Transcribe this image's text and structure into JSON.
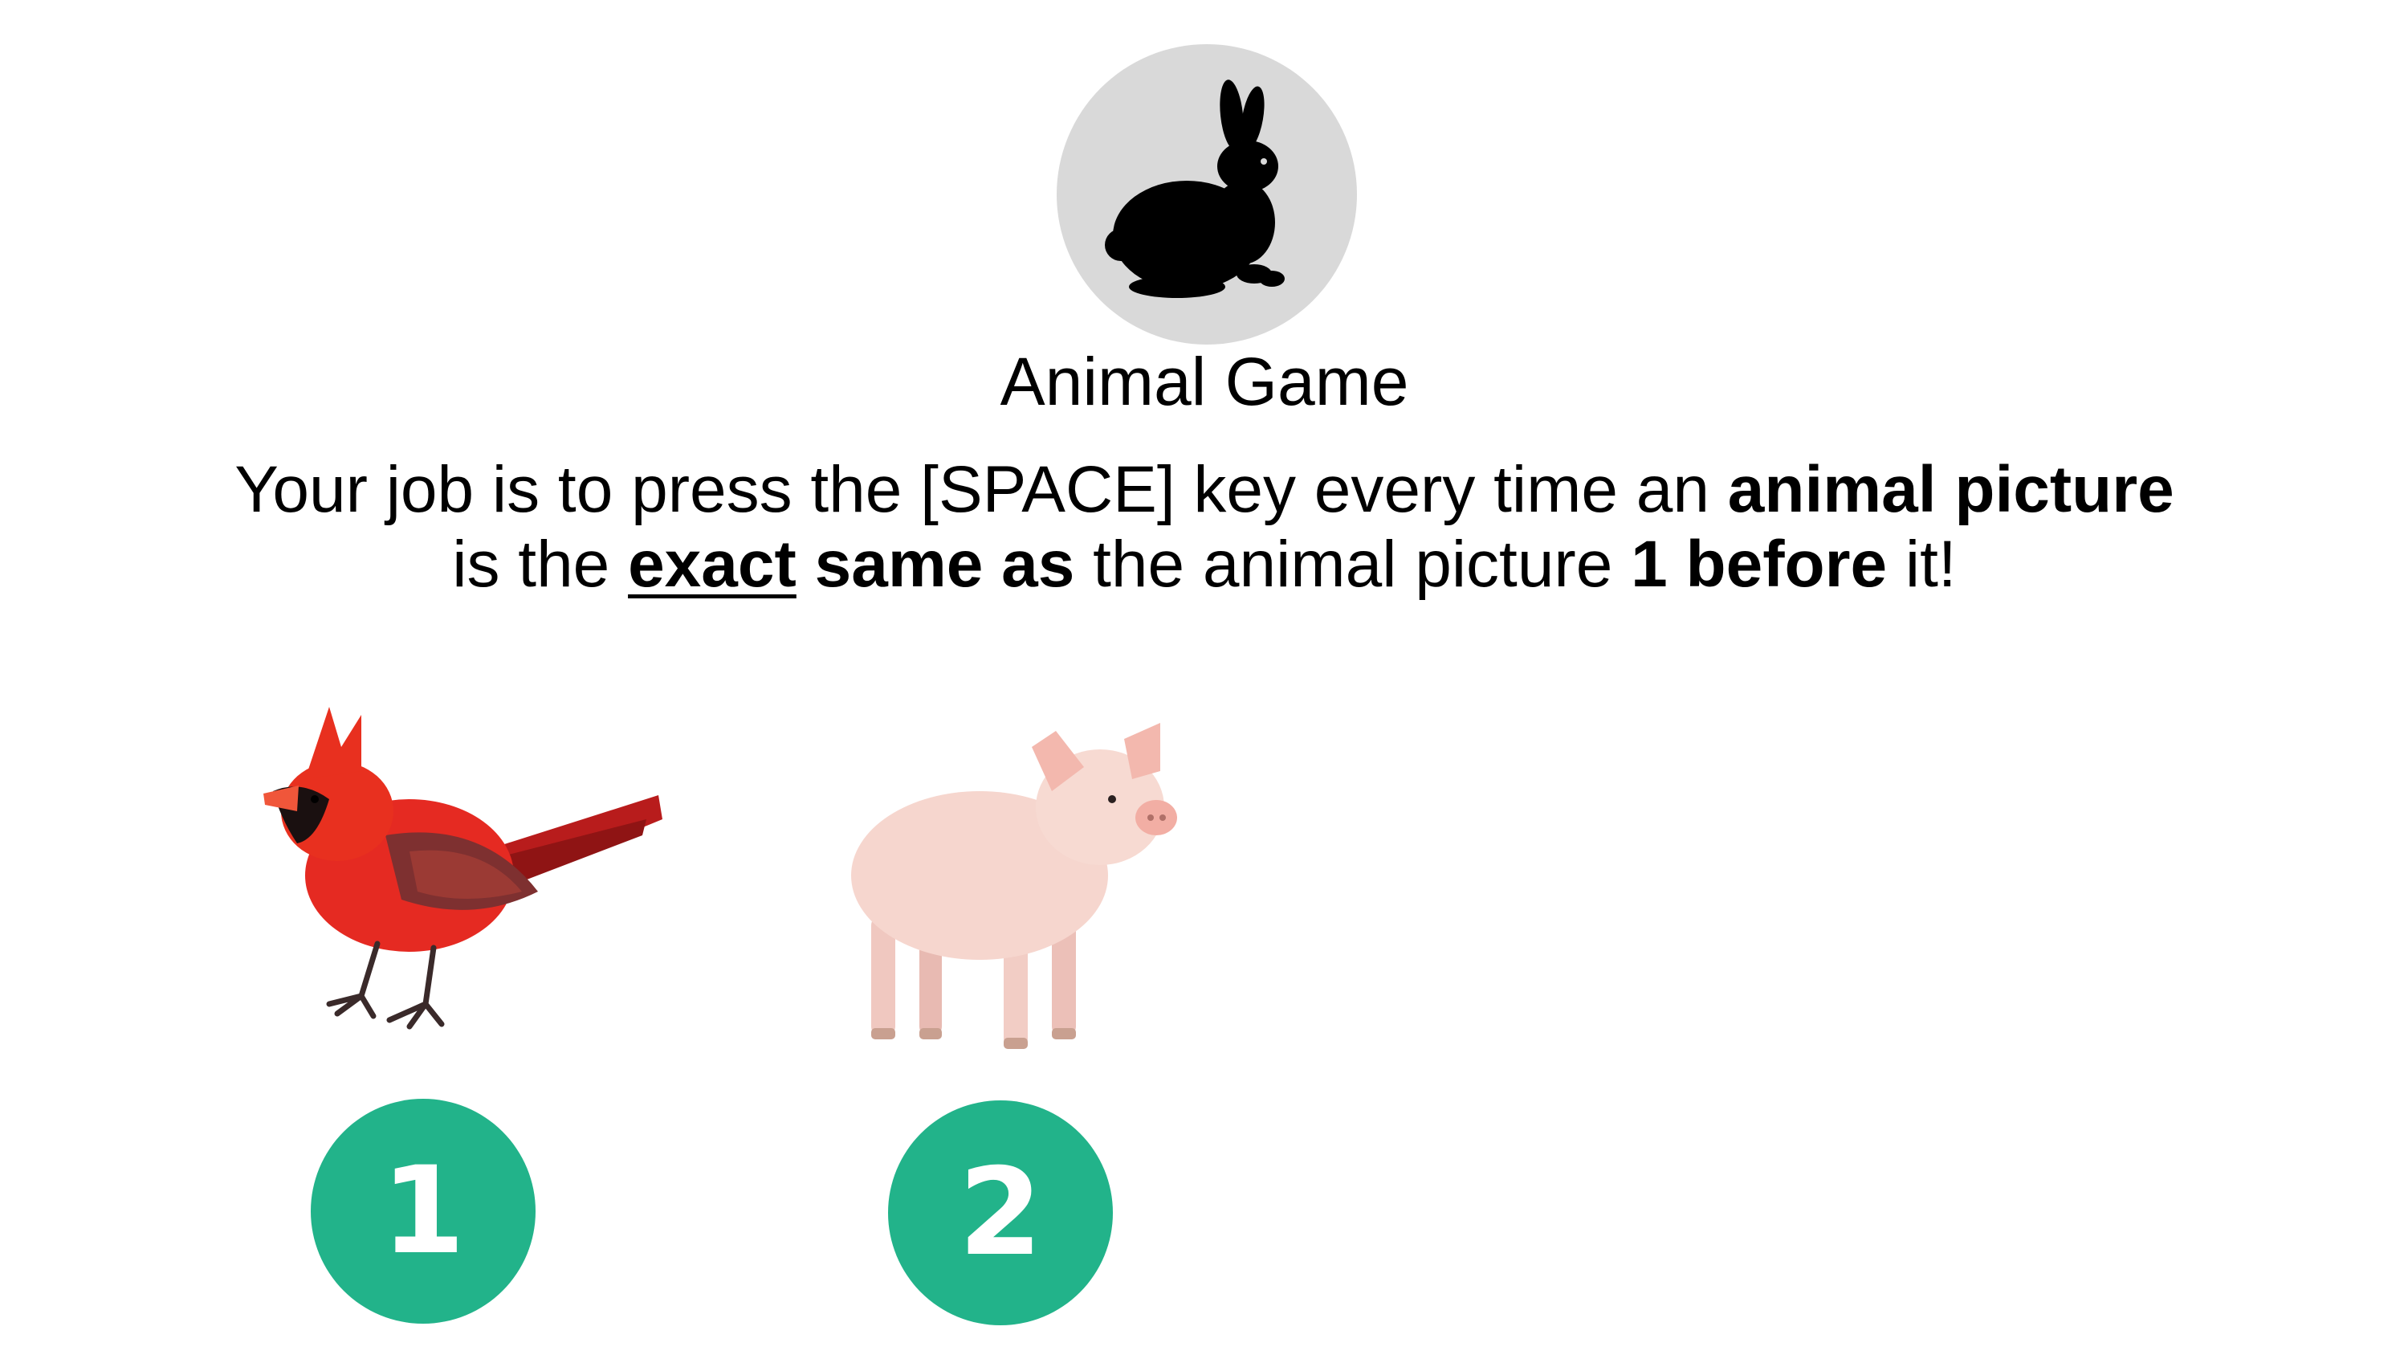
{
  "logo": {
    "icon": "rabbit-silhouette-icon",
    "background": "#d9d9d9"
  },
  "title": "Animal Game",
  "instructions": {
    "line1": {
      "part1": "Your job is to press the [SPACE] key every time an ",
      "bold1": "animal picture"
    },
    "line2": {
      "part1": "is the ",
      "underlined_bold": "exact",
      "space": " ",
      "bold1": "same as",
      "part2": " the animal picture ",
      "bold2": "1 before",
      "part3": " it!"
    }
  },
  "examples": [
    {
      "icon": "cardinal-bird-icon",
      "number": "1"
    },
    {
      "icon": "pig-icon",
      "number": "2"
    }
  ],
  "colors": {
    "badge": "#22b38a",
    "text": "#000000",
    "background": "#ffffff"
  }
}
